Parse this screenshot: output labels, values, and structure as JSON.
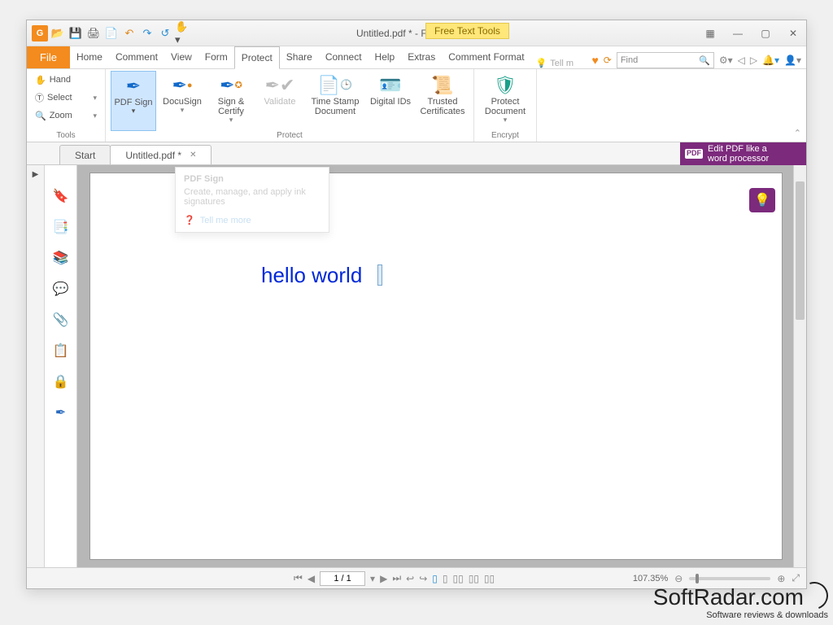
{
  "qat": {
    "title_doc": "Untitled.pdf *",
    "title_sep": " - ",
    "title_app": "Foxit Reader",
    "free_tools": "Free Text Tools"
  },
  "tabs": {
    "file": "File",
    "items": [
      "Home",
      "Comment",
      "View",
      "Form",
      "Protect",
      "Share",
      "Connect",
      "Help",
      "Extras",
      "Comment Format"
    ],
    "active_index": 4,
    "tellme_label": "Tell m",
    "find_placeholder": "Find"
  },
  "ribbon": {
    "tools_group": "Tools",
    "protect_group": "Protect",
    "encrypt_group": "Encrypt",
    "hand": "Hand",
    "select": "Select",
    "zoom": "Zoom",
    "pdf_sign": "PDF Sign",
    "docusign": "DocuSign",
    "sign_certify": "Sign & Certify",
    "validate": "Validate",
    "timestamp": "Time Stamp Document",
    "digital_ids": "Digital IDs",
    "trusted_certs": "Trusted Certificates",
    "protect_doc": "Protect Document"
  },
  "doctabs": {
    "start": "Start",
    "doc": "Untitled.pdf *"
  },
  "purple_banner": {
    "line1": "Edit PDF like a",
    "line2": "word processor",
    "badge": "PDF"
  },
  "tooltip": {
    "title": "PDF Sign",
    "body": "Create, manage, and apply ink signatures",
    "more": "Tell me more"
  },
  "document": {
    "text": "hello world"
  },
  "status": {
    "page_field": "1 / 1",
    "zoom_pct": "107.35%"
  },
  "watermark": {
    "brand": "SoftRadar.com",
    "tag": "Software reviews & downloads"
  }
}
